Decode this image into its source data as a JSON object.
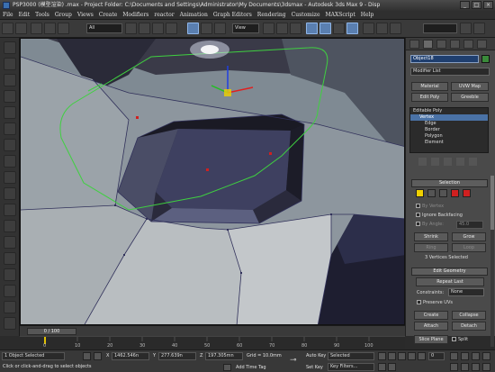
{
  "title_bar": {
    "text": "PSP3000 (模型渲染) .max  - Project Folder: C:\\Documents and Settings\\Administrator\\My Documents\\3dsmax  - Autodesk 3ds Max 9  - Disp",
    "min_label": "_",
    "max_label": "□",
    "close_label": "×"
  },
  "menu": [
    "File",
    "Edit",
    "Tools",
    "Group",
    "Views",
    "Create",
    "Modifiers",
    "reactor",
    "Animation",
    "Graph Editors",
    "Rendering",
    "Customize",
    "MAXScript",
    "Help"
  ],
  "toolbar": {
    "selection_filter": "All",
    "ref_coord": "View"
  },
  "command_panel": {
    "object_name": "Object18",
    "modifier_list": "Modifier List",
    "buttons_row1": [
      "Material",
      "UVW Map"
    ],
    "buttons_row2": [
      "Edit Poly",
      "Greeble"
    ],
    "stack": [
      "Editable Poly",
      "Vertex",
      "Edge",
      "Border",
      "Polygon",
      "Element"
    ],
    "stack_selected_index": 1,
    "selection_header": "Selection",
    "by_vertex": "By Vertex",
    "ignore_backfacing": "Ignore Backfacing",
    "by_angle": "By Angle:",
    "angle_value": "45.0",
    "shrink": "Shrink",
    "grow": "Grow",
    "ring": "Ring",
    "loop": "Loop",
    "selected_status": "3 Vertices Selected",
    "edit_geometry_header": "Edit Geometry",
    "repeat_last": "Repeat Last",
    "constraints_label": "Constraints:",
    "constraints_value": "None",
    "preserve_uvs": "Preserve UVs",
    "create": "Create",
    "collapse": "Collapse",
    "attach": "Attach",
    "detach": "Detach",
    "slice_plane": "Slice Plane",
    "split": "Split"
  },
  "timeline": {
    "frame_label": "0 / 100",
    "ticks": [
      "0",
      "10",
      "20",
      "30",
      "40",
      "50",
      "60",
      "70",
      "80",
      "90",
      "100"
    ]
  },
  "status": {
    "selection": "1 Object Selected",
    "prompt": "Click or click-and-drag to select objects",
    "x_label": "X",
    "x_value": "1462.546n",
    "y_label": "Y",
    "y_value": "277.639n",
    "z_label": "Z",
    "z_value": "197.305mn",
    "grid": "Grid = 10.0mm",
    "add_time_tag": "Add Time Tag",
    "auto_key": "Auto Key",
    "auto_key_value": "Selected",
    "set_key": "Set Key",
    "key_filters": "Key Filters...",
    "frame": "0"
  },
  "colors": {
    "viewport_bg": "#7f8a93",
    "selection_accent": "#4a72a6",
    "vertex_red": "#d02020",
    "vertex_yellow": "#f0d000",
    "wire_green": "#3fd040"
  }
}
